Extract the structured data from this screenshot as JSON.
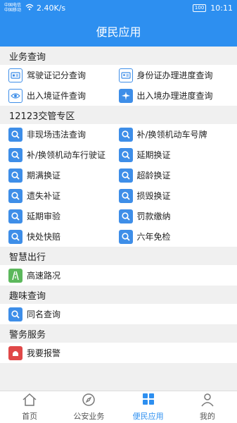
{
  "statusbar": {
    "carrier1": "中国电信",
    "carrier2": "中国移动",
    "speed": "2.40K/s",
    "battery": "100",
    "time": "10:11"
  },
  "title": "便民应用",
  "sections": [
    {
      "header": "业务查询",
      "items": [
        {
          "label": "驾驶证记分查询",
          "icon": "card-icon"
        },
        {
          "label": "身份证办理进度查询",
          "icon": "id-card-icon"
        },
        {
          "label": "出入境证件查询",
          "icon": "eye-icon"
        },
        {
          "label": "出入境办理进度查询",
          "icon": "airplane-icon"
        }
      ]
    },
    {
      "header": "12123交管专区",
      "items": [
        {
          "label": "非现场违法查询",
          "icon": "search-icon"
        },
        {
          "label": "补/换领机动车号牌",
          "icon": "search-icon"
        },
        {
          "label": "补/换领机动车行驶证",
          "icon": "search-icon"
        },
        {
          "label": "延期换证",
          "icon": "search-icon"
        },
        {
          "label": "期满换证",
          "icon": "search-icon"
        },
        {
          "label": "超龄换证",
          "icon": "search-icon"
        },
        {
          "label": "遗失补证",
          "icon": "search-icon"
        },
        {
          "label": "损毁换证",
          "icon": "search-icon"
        },
        {
          "label": "延期审验",
          "icon": "search-icon"
        },
        {
          "label": "罚款缴纳",
          "icon": "search-icon"
        },
        {
          "label": "快处快赔",
          "icon": "search-icon"
        },
        {
          "label": "六年免检",
          "icon": "search-icon"
        }
      ]
    },
    {
      "header": "智慧出行",
      "items": [
        {
          "label": "高速路况",
          "icon": "road-icon"
        }
      ]
    },
    {
      "header": "趣味查询",
      "items": [
        {
          "label": "同名查询",
          "icon": "search-icon"
        }
      ]
    },
    {
      "header": "警务服务",
      "items": [
        {
          "label": "我要报警",
          "icon": "alarm-icon"
        }
      ]
    }
  ],
  "tabs": [
    {
      "label": "首页",
      "icon": "home-icon",
      "active": false
    },
    {
      "label": "公安业务",
      "icon": "compass-icon",
      "active": false
    },
    {
      "label": "便民应用",
      "icon": "grid-icon",
      "active": true
    },
    {
      "label": "我的",
      "icon": "user-icon",
      "active": false
    }
  ],
  "colors": {
    "primary": "#2d8ff0",
    "icon_blue": "#3e8ee8",
    "icon_green": "#5cb85c",
    "alarm_red": "#e04848"
  }
}
